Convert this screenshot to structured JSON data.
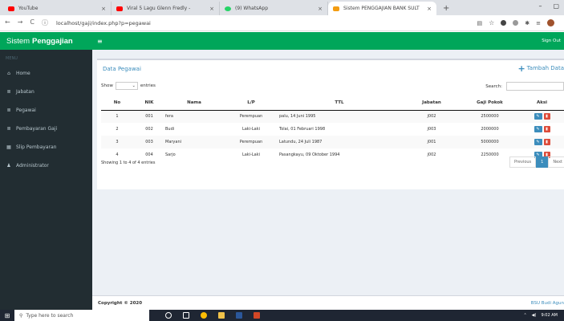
{
  "browser": {
    "tabs": [
      {
        "label": "YouTube",
        "color": "#ff0000"
      },
      {
        "label": "Viral 5 Lagu Glenn Fredly - ",
        "color": "#ff0000"
      },
      {
        "label": "(9) WhatsApp",
        "color": "#25d366"
      },
      {
        "label": "Sistem PENGGAJIAN BANK SULT",
        "color": "#f39c12"
      }
    ],
    "url": "localhost/gaji/index.php?p=pegawai"
  },
  "brand": {
    "prefix": "Sistem",
    "name": "Penggajian"
  },
  "topbar": {
    "toggle": "≡",
    "signout": "Sign Out"
  },
  "menu": {
    "header": "MENU",
    "items": [
      {
        "label": "Home",
        "icon": "home-icon"
      },
      {
        "label": "Jabatan",
        "icon": "list-icon"
      },
      {
        "label": "Pegawai",
        "icon": "list-icon"
      },
      {
        "label": "Pembayaran Gaji",
        "icon": "list-icon"
      },
      {
        "label": "Slip Pembayaran",
        "icon": "table-icon"
      },
      {
        "label": "Administrator",
        "icon": "user-icon"
      }
    ]
  },
  "panel": {
    "title": "Data Pegawai",
    "add_label": "Tambah Data",
    "show_label": "Show",
    "entries_label": "entries",
    "search_label": "Search:"
  },
  "table": {
    "headers": [
      "No",
      "NIK",
      "Nama",
      "L/P",
      "TTL",
      "Jabatan",
      "Gaji Pokok",
      "Aksi"
    ],
    "rows": [
      {
        "no": "1",
        "nik": "001",
        "nama": "fera",
        "lp": "Perempuan",
        "ttl": "palu, 14 Juni 1995",
        "jabatan": "j002",
        "gaji": "2500000"
      },
      {
        "no": "2",
        "nik": "002",
        "nama": "Budi",
        "lp": "Laki-Laki",
        "ttl": "Tolai, 01 Februari 1998",
        "jabatan": "j003",
        "gaji": "2000000"
      },
      {
        "no": "3",
        "nik": "003",
        "nama": "Maryani",
        "lp": "Perempuan",
        "ttl": "Latundu, 24 Juli 1987",
        "jabatan": "j001",
        "gaji": "5000000"
      },
      {
        "no": "4",
        "nik": "004",
        "nama": "Sarjo",
        "lp": "Laki-Laki",
        "ttl": "Pasangkayu, 09 Oktober 1994",
        "jabatan": "j002",
        "gaji": "2250000"
      }
    ],
    "info": "Showing 1 to 4 of 4 entries",
    "pager": {
      "prev": "Previous",
      "page": "1",
      "next": "Next"
    }
  },
  "footer": {
    "copyright": "Copyright © 2020",
    "right": "BSU Budi Agun"
  },
  "taskbar": {
    "search_placeholder": "Type here to search",
    "time": "9:02 AM"
  },
  "colors": {
    "primary": "#00a65a",
    "sidebar": "#222d32",
    "link": "#3c8dbc",
    "danger": "#dd4b39"
  }
}
